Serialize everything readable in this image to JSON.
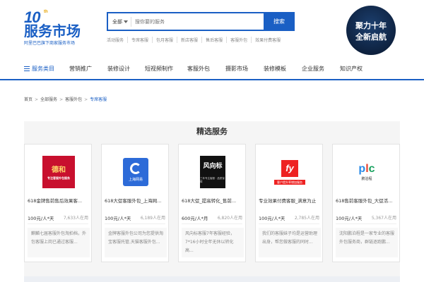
{
  "header": {
    "logo_ten": "10",
    "logo_ten_sup": "th",
    "logo_brand": "服务市场",
    "logo_slogan": "阿里巴巴旗下商家服务市场",
    "search": {
      "category": "全部",
      "placeholder": "搜你要的服务",
      "button_label": "搜索"
    },
    "hot_links": [
      "活动服务",
      "专席客服",
      "包月客服",
      "新店客服",
      "售后客服",
      "客服外包",
      "效果付费客服"
    ],
    "promo_line1": "聚力十年",
    "promo_line2": "全新启航"
  },
  "nav": {
    "items": [
      "服务类目",
      "营销推广",
      "装修设计",
      "短视频制作",
      "客服外包",
      "摄影市场",
      "装修模板",
      "企业服务",
      "知识产权"
    ]
  },
  "breadcrumb": {
    "items": [
      "首页",
      "全部服务",
      "客服外包"
    ],
    "current": "专席客服"
  },
  "featured": {
    "title": "精选服务",
    "cards": [
      {
        "logo_text": "德和",
        "logo_sub": "专注客服外包服务",
        "name": "618金牌售前售后效果客...",
        "price": "100元/人*天",
        "sold": "7,633人在用",
        "desc": "麒麟七届客服外包淘拍档，外包客服上岗已通过客服..."
      },
      {
        "logo_text": "上海网易",
        "name": "618大促客服外包_上海网...",
        "price": "100元/人*天",
        "sold": "6,189人在用",
        "desc": "金牌客服外包公司为您提供淘宝客服托管,天猫客服外包..."
      },
      {
        "logo_text": "风向标",
        "logo_sub": "三年专注客服 · 品质保障",
        "name": "618大促_提高转化_售前...",
        "price": "600元/人*月",
        "sold": "6,820人在用",
        "desc": "风向标客服7年客服经验，7*16小时全年无休以转化高..."
      },
      {
        "logo_text": "fy",
        "logo_sub": "客户提升率增加服务",
        "name": "专业效果付费客服_满意为止",
        "price": "100元/人*天",
        "sold": "2,785人在用",
        "desc": "我们的客服妹子均是运营助理出身，帮您做客服的同时..."
      },
      {
        "logo_text": "plc",
        "logo_sub": "鹏泊程",
        "name": "618售前客服外包_大促活...",
        "price": "100元/人*天",
        "sold": "5,367人在用",
        "desc": "沈阳鹏泊程是一家专业的客服外包服务商，群链逐跑鹏..."
      }
    ]
  },
  "colors": {
    "accent": "#1a5fc4",
    "section_bg": "#f5f5f5"
  }
}
